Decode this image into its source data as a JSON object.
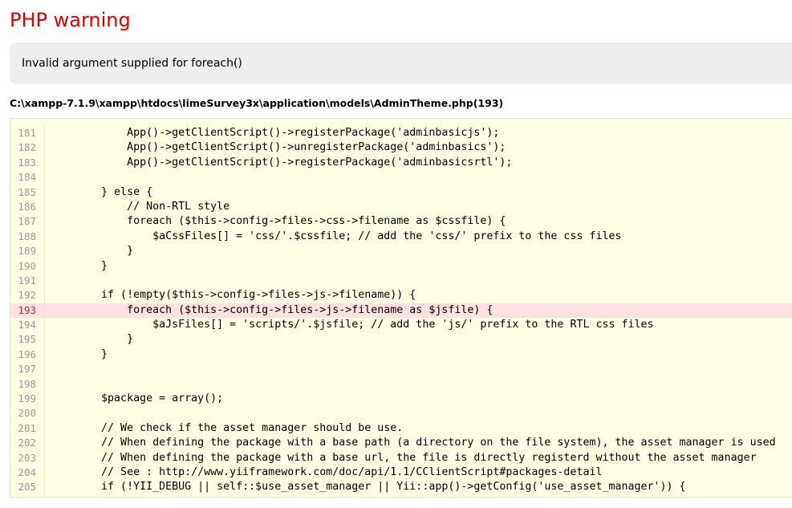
{
  "warning": {
    "title": "PHP warning",
    "message": "Invalid argument supplied for foreach()",
    "file_location": "C:\\xampp-7.1.9\\xampp\\htdocs\\limeSurvey3x\\application\\models\\AdminTheme.php(193)"
  },
  "source": {
    "error_line": 193,
    "lines": [
      {
        "num": "181",
        "code": "            App()->getClientScript()->registerPackage('adminbasicjs');"
      },
      {
        "num": "182",
        "code": "            App()->getClientScript()->unregisterPackage('adminbasics');"
      },
      {
        "num": "183",
        "code": "            App()->getClientScript()->registerPackage('adminbasicsrtl');"
      },
      {
        "num": "184",
        "code": ""
      },
      {
        "num": "185",
        "code": "        } else {"
      },
      {
        "num": "186",
        "code": "            // Non-RTL style"
      },
      {
        "num": "187",
        "code": "            foreach ($this->config->files->css->filename as $cssfile) {"
      },
      {
        "num": "188",
        "code": "                $aCssFiles[] = 'css/'.$cssfile; // add the 'css/' prefix to the css files"
      },
      {
        "num": "189",
        "code": "            }"
      },
      {
        "num": "190",
        "code": "        }"
      },
      {
        "num": "191",
        "code": ""
      },
      {
        "num": "192",
        "code": "        if (!empty($this->config->files->js->filename)) {"
      },
      {
        "num": "193",
        "code": "            foreach ($this->config->files->js->filename as $jsfile) {"
      },
      {
        "num": "194",
        "code": "                $aJsFiles[] = 'scripts/'.$jsfile; // add the 'js/' prefix to the RTL css files"
      },
      {
        "num": "195",
        "code": "            }"
      },
      {
        "num": "196",
        "code": "        }"
      },
      {
        "num": "197",
        "code": ""
      },
      {
        "num": "198",
        "code": ""
      },
      {
        "num": "199",
        "code": "        $package = array();"
      },
      {
        "num": "200",
        "code": ""
      },
      {
        "num": "201",
        "code": "        // We check if the asset manager should be use."
      },
      {
        "num": "202",
        "code": "        // When defining the package with a base path (a directory on the file system), the asset manager is used"
      },
      {
        "num": "203",
        "code": "        // When defining the package with a base url, the file is directly registerd without the asset manager"
      },
      {
        "num": "204",
        "code": "        // See : http://www.yiiframework.com/doc/api/1.1/CClientScript#packages-detail"
      },
      {
        "num": "205",
        "code": "        if (!YII_DEBUG || self::$use_asset_manager || Yii::app()->getConfig('use_asset_manager')) {"
      }
    ]
  }
}
